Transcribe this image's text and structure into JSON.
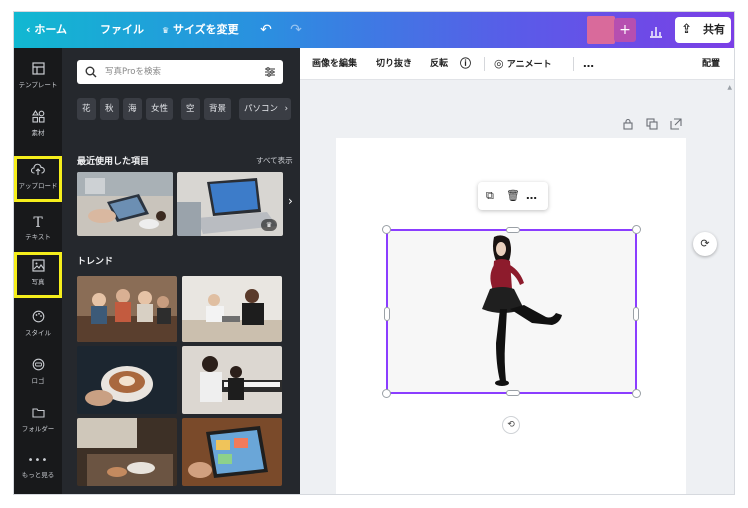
{
  "topbar": {
    "home": "ホーム",
    "file": "ファイル",
    "resize": "サイズを変更",
    "share": "共有"
  },
  "rail": {
    "items": [
      {
        "label": "テンプレート",
        "icon": "template-icon"
      },
      {
        "label": "素材",
        "icon": "elements-icon"
      },
      {
        "label": "アップロード",
        "icon": "upload-icon"
      },
      {
        "label": "テキスト",
        "icon": "text-icon"
      },
      {
        "label": "写真",
        "icon": "photo-icon"
      },
      {
        "label": "スタイル",
        "icon": "style-icon"
      },
      {
        "label": "ロゴ",
        "icon": "logo-icon"
      },
      {
        "label": "フォルダー",
        "icon": "folder-icon"
      },
      {
        "label": "もっと見る",
        "icon": "more-icon"
      }
    ],
    "highlight_color": "#f5ee1c"
  },
  "panel": {
    "search_placeholder": "写真Proを検索",
    "chips": [
      "花",
      "秋",
      "海",
      "女性",
      "空",
      "背景",
      "パソコン"
    ],
    "recent_title": "最近使用した項目",
    "see_all": "すべて表示",
    "trend_title": "トレンド"
  },
  "toolbar": {
    "edit_image": "画像を編集",
    "crop": "切り抜き",
    "flip": "反転",
    "animate": "アニメート",
    "more": "…",
    "position": "配置"
  },
  "colors": {
    "topbar_start": "#11b8d1",
    "topbar_end": "#7b3fe6",
    "selection": "#8b3dff",
    "panel_bg": "#25282d",
    "rail_bg": "#18191b"
  }
}
